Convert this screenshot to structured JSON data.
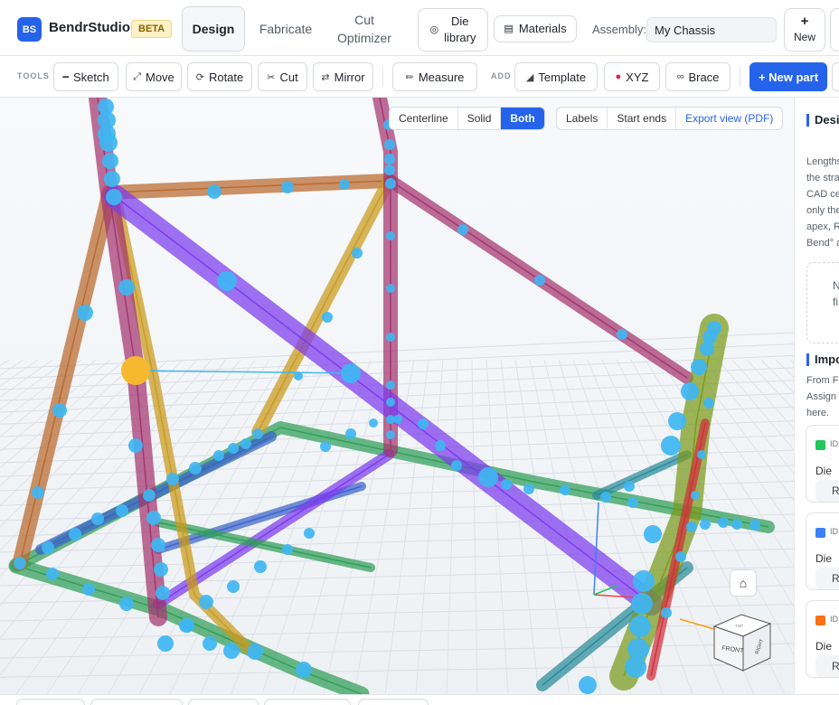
{
  "header": {
    "logo": "BS",
    "brand": "BendrStudio",
    "badge": "BETA",
    "tabs": [
      {
        "label": "Design"
      },
      {
        "label": "Fabricate"
      },
      {
        "label": "Cut\nOptimizer"
      }
    ],
    "die_library": "Die\nlibrary",
    "materials": "Materials",
    "assembly_label": "Assembly:",
    "assembly_value": "My Chassis",
    "new_label": "New",
    "new_icon": "plus-icon"
  },
  "toolbar": {
    "tools_label": "TOOLS",
    "add_label": "ADD",
    "tools": [
      {
        "label": "Sketch",
        "icon": "sketch-icon"
      },
      {
        "label": "Move",
        "icon": "move-icon"
      },
      {
        "label": "Rotate",
        "icon": "rotate-icon"
      },
      {
        "label": "Cut",
        "icon": "scissors-icon"
      },
      {
        "label": "Mirror",
        "icon": "mirror-icon"
      },
      {
        "label": "Measure",
        "icon": "ruler-icon"
      }
    ],
    "add": [
      {
        "label": "Template",
        "icon": "template-icon"
      },
      {
        "label": "XYZ",
        "icon": "pin-icon"
      },
      {
        "label": "Brace",
        "icon": "link-icon"
      }
    ],
    "new_part": "+ New part"
  },
  "viewport": {
    "view_modes": [
      "Centerline",
      "Solid",
      "Both"
    ],
    "active_view_mode": "Both",
    "overlays": [
      "Labels",
      "Start ends"
    ],
    "export": "Export view (PDF)",
    "cube_front": "FRONT",
    "cube_right": "RIGHT",
    "cube_top": "TOP",
    "colors": {
      "magenta": "#a3346f",
      "orange": "#b8682c",
      "purple": "#7c3aed",
      "green": "#2f9e57",
      "blue": "#3b63c9",
      "yellow": "#c99a1c",
      "olive": "#7a9a1a",
      "teal": "#2a8a9a",
      "red": "#d0303c",
      "node": "#3fb6f2",
      "selected": "#f5b82e"
    }
  },
  "panel": {
    "title": "Design",
    "intro_lines": [
      "Lengths",
      "the stra",
      "CAD cer",
      "only the",
      "apex, R",
      "Bend° a"
    ],
    "dash_lines": [
      "N",
      "fi"
    ],
    "import_title": "Impo",
    "import_lines": [
      "From Fu",
      "Assign a",
      "here."
    ],
    "die_label": "Die",
    "dies": [
      {
        "id": "ID",
        "color": "#22c55e",
        "value": "Rog"
      },
      {
        "id": "ID",
        "color": "#3b82f6",
        "value": "Rog"
      },
      {
        "id": "ID",
        "color": "#f97316",
        "value": "Rog"
      }
    ]
  }
}
